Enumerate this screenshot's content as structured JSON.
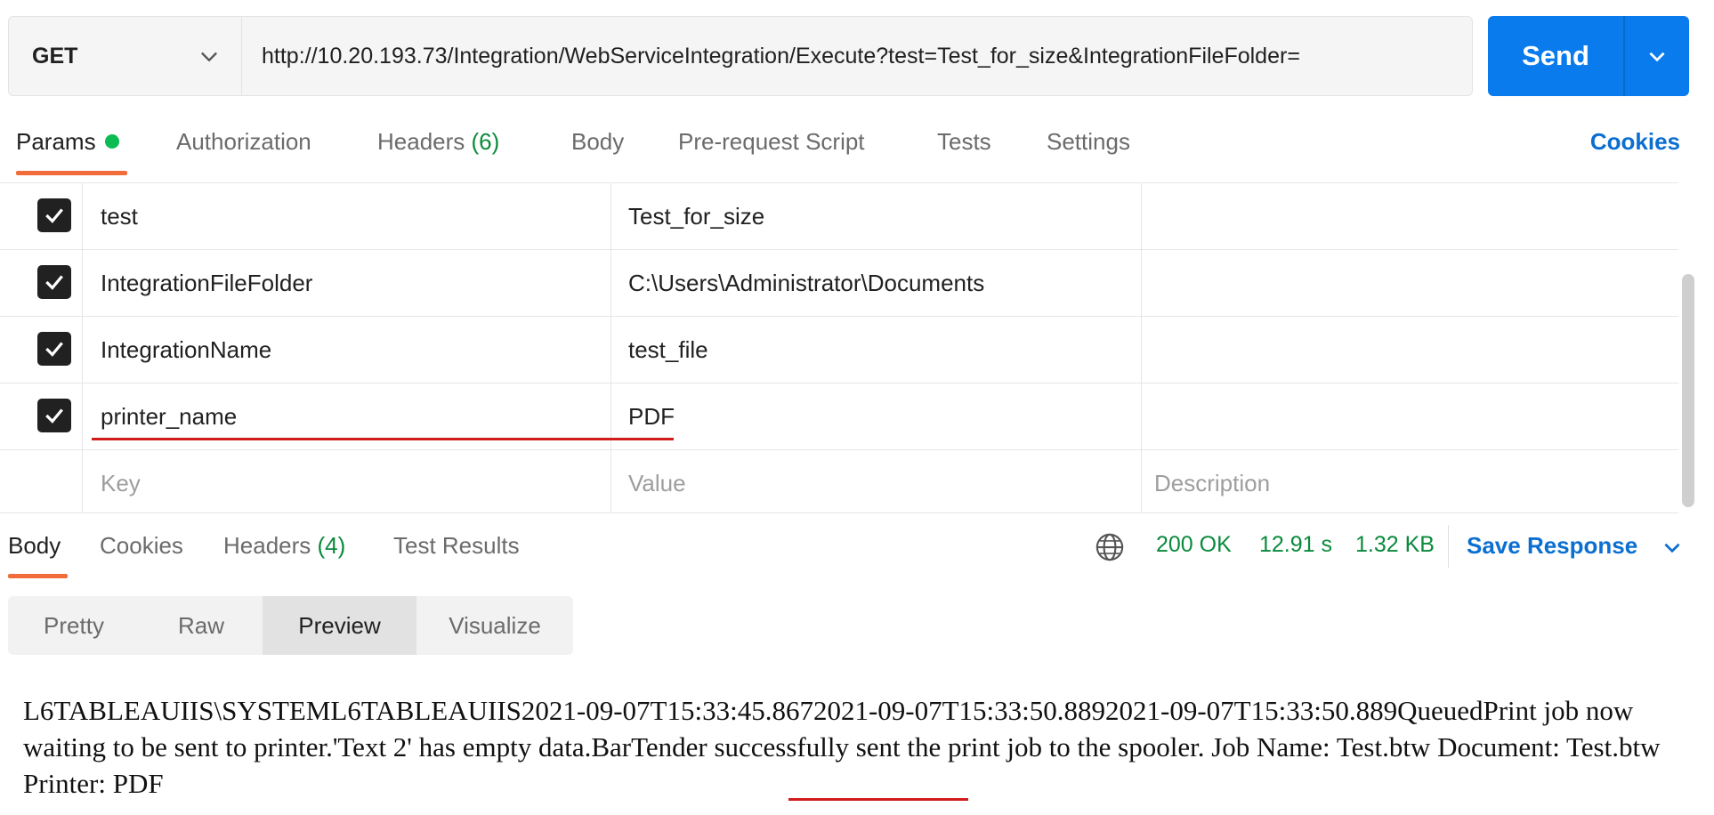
{
  "request": {
    "method": "GET",
    "url": "http://10.20.193.73/Integration/WebServiceIntegration/Execute?test=Test_for_size&IntegrationFileFolder=",
    "send_label": "Send"
  },
  "request_tabs": {
    "params": "Params",
    "authorization": "Authorization",
    "headers": "Headers",
    "headers_count": "(6)",
    "body": "Body",
    "prerequest": "Pre-request Script",
    "tests": "Tests",
    "settings": "Settings",
    "cookies": "Cookies"
  },
  "params": {
    "rows": [
      {
        "key": "test",
        "value": "Test_for_size",
        "description": ""
      },
      {
        "key": "IntegrationFileFolder",
        "value": "C:\\Users\\Administrator\\Documents",
        "description": ""
      },
      {
        "key": "IntegrationName",
        "value": "test_file",
        "description": ""
      },
      {
        "key": "printer_name",
        "value": "PDF",
        "description": ""
      }
    ],
    "placeholder_key": "Key",
    "placeholder_value": "Value",
    "placeholder_description": "Description"
  },
  "response_tabs": {
    "body": "Body",
    "cookies": "Cookies",
    "headers": "Headers",
    "headers_count": "(4)",
    "test_results": "Test Results"
  },
  "response_status": {
    "status": "200 OK",
    "time": "12.91 s",
    "size": "1.32 KB",
    "save_response": "Save Response"
  },
  "format_tabs": [
    "Pretty",
    "Raw",
    "Preview",
    "Visualize"
  ],
  "preview": {
    "text": "L6TABLEAUIIS\\SYSTEML6TABLEAUIIS2021-09-07T15:33:45.8672021-09-07T15:33:50.8892021-09-07T15:33:50.889QueuedPrint job now waiting to be sent to printer.'Text 2' has empty data.BarTender successfully sent the print job to the spooler. Job Name: Test.btw Document: Test.btw Printer: PDF"
  },
  "colors": {
    "accent": "#097bed",
    "tab_underline": "#f26b3a",
    "status_green": "#0a8a3c",
    "annotation_red": "#d21c1c"
  }
}
